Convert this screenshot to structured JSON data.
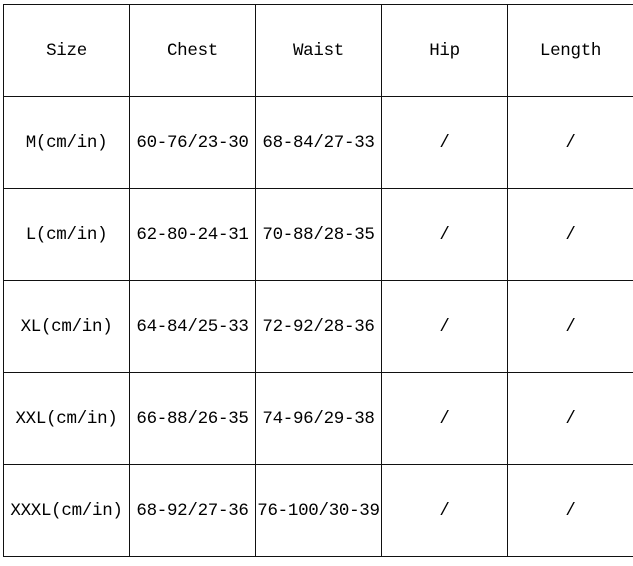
{
  "table": {
    "headers": [
      "Size",
      "Chest",
      "Waist",
      "Hip",
      "Length"
    ],
    "rows": [
      [
        "M(cm/in)",
        "60-76/23-30",
        "68-84/27-33",
        "/",
        "/"
      ],
      [
        "L(cm/in)",
        "62-80-24-31",
        "70-88/28-35",
        "/",
        "/"
      ],
      [
        "XL(cm/in)",
        "64-84/25-33",
        "72-92/28-36",
        "/",
        "/"
      ],
      [
        "XXL(cm/in)",
        "66-88/26-35",
        "74-96/29-38",
        "/",
        "/"
      ],
      [
        "XXXL(cm/in)",
        "68-92/27-36",
        "76-100/30-39",
        "/",
        "/"
      ]
    ]
  }
}
